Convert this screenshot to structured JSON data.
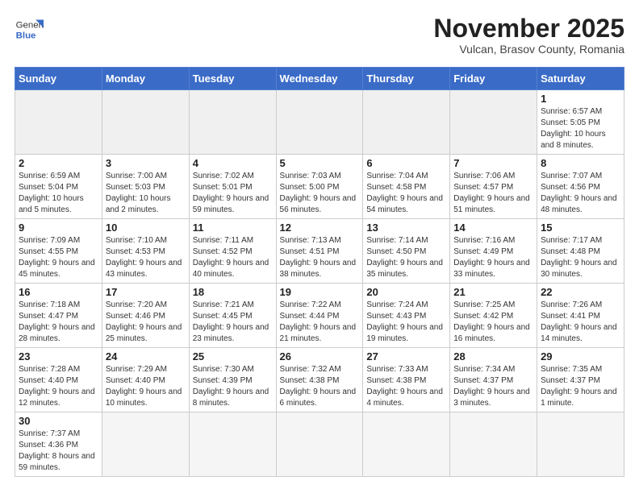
{
  "header": {
    "logo_general": "General",
    "logo_blue": "Blue",
    "month_title": "November 2025",
    "subtitle": "Vulcan, Brasov County, Romania"
  },
  "weekdays": [
    "Sunday",
    "Monday",
    "Tuesday",
    "Wednesday",
    "Thursday",
    "Friday",
    "Saturday"
  ],
  "weeks": [
    [
      {
        "day": "",
        "info": ""
      },
      {
        "day": "",
        "info": ""
      },
      {
        "day": "",
        "info": ""
      },
      {
        "day": "",
        "info": ""
      },
      {
        "day": "",
        "info": ""
      },
      {
        "day": "",
        "info": ""
      },
      {
        "day": "1",
        "info": "Sunrise: 6:57 AM\nSunset: 5:05 PM\nDaylight: 10 hours and 8 minutes."
      }
    ],
    [
      {
        "day": "2",
        "info": "Sunrise: 6:59 AM\nSunset: 5:04 PM\nDaylight: 10 hours and 5 minutes."
      },
      {
        "day": "3",
        "info": "Sunrise: 7:00 AM\nSunset: 5:03 PM\nDaylight: 10 hours and 2 minutes."
      },
      {
        "day": "4",
        "info": "Sunrise: 7:02 AM\nSunset: 5:01 PM\nDaylight: 9 hours and 59 minutes."
      },
      {
        "day": "5",
        "info": "Sunrise: 7:03 AM\nSunset: 5:00 PM\nDaylight: 9 hours and 56 minutes."
      },
      {
        "day": "6",
        "info": "Sunrise: 7:04 AM\nSunset: 4:58 PM\nDaylight: 9 hours and 54 minutes."
      },
      {
        "day": "7",
        "info": "Sunrise: 7:06 AM\nSunset: 4:57 PM\nDaylight: 9 hours and 51 minutes."
      },
      {
        "day": "8",
        "info": "Sunrise: 7:07 AM\nSunset: 4:56 PM\nDaylight: 9 hours and 48 minutes."
      }
    ],
    [
      {
        "day": "9",
        "info": "Sunrise: 7:09 AM\nSunset: 4:55 PM\nDaylight: 9 hours and 45 minutes."
      },
      {
        "day": "10",
        "info": "Sunrise: 7:10 AM\nSunset: 4:53 PM\nDaylight: 9 hours and 43 minutes."
      },
      {
        "day": "11",
        "info": "Sunrise: 7:11 AM\nSunset: 4:52 PM\nDaylight: 9 hours and 40 minutes."
      },
      {
        "day": "12",
        "info": "Sunrise: 7:13 AM\nSunset: 4:51 PM\nDaylight: 9 hours and 38 minutes."
      },
      {
        "day": "13",
        "info": "Sunrise: 7:14 AM\nSunset: 4:50 PM\nDaylight: 9 hours and 35 minutes."
      },
      {
        "day": "14",
        "info": "Sunrise: 7:16 AM\nSunset: 4:49 PM\nDaylight: 9 hours and 33 minutes."
      },
      {
        "day": "15",
        "info": "Sunrise: 7:17 AM\nSunset: 4:48 PM\nDaylight: 9 hours and 30 minutes."
      }
    ],
    [
      {
        "day": "16",
        "info": "Sunrise: 7:18 AM\nSunset: 4:47 PM\nDaylight: 9 hours and 28 minutes."
      },
      {
        "day": "17",
        "info": "Sunrise: 7:20 AM\nSunset: 4:46 PM\nDaylight: 9 hours and 25 minutes."
      },
      {
        "day": "18",
        "info": "Sunrise: 7:21 AM\nSunset: 4:45 PM\nDaylight: 9 hours and 23 minutes."
      },
      {
        "day": "19",
        "info": "Sunrise: 7:22 AM\nSunset: 4:44 PM\nDaylight: 9 hours and 21 minutes."
      },
      {
        "day": "20",
        "info": "Sunrise: 7:24 AM\nSunset: 4:43 PM\nDaylight: 9 hours and 19 minutes."
      },
      {
        "day": "21",
        "info": "Sunrise: 7:25 AM\nSunset: 4:42 PM\nDaylight: 9 hours and 16 minutes."
      },
      {
        "day": "22",
        "info": "Sunrise: 7:26 AM\nSunset: 4:41 PM\nDaylight: 9 hours and 14 minutes."
      }
    ],
    [
      {
        "day": "23",
        "info": "Sunrise: 7:28 AM\nSunset: 4:40 PM\nDaylight: 9 hours and 12 minutes."
      },
      {
        "day": "24",
        "info": "Sunrise: 7:29 AM\nSunset: 4:40 PM\nDaylight: 9 hours and 10 minutes."
      },
      {
        "day": "25",
        "info": "Sunrise: 7:30 AM\nSunset: 4:39 PM\nDaylight: 9 hours and 8 minutes."
      },
      {
        "day": "26",
        "info": "Sunrise: 7:32 AM\nSunset: 4:38 PM\nDaylight: 9 hours and 6 minutes."
      },
      {
        "day": "27",
        "info": "Sunrise: 7:33 AM\nSunset: 4:38 PM\nDaylight: 9 hours and 4 minutes."
      },
      {
        "day": "28",
        "info": "Sunrise: 7:34 AM\nSunset: 4:37 PM\nDaylight: 9 hours and 3 minutes."
      },
      {
        "day": "29",
        "info": "Sunrise: 7:35 AM\nSunset: 4:37 PM\nDaylight: 9 hours and 1 minute."
      }
    ],
    [
      {
        "day": "30",
        "info": "Sunrise: 7:37 AM\nSunset: 4:36 PM\nDaylight: 8 hours and 59 minutes."
      },
      {
        "day": "",
        "info": ""
      },
      {
        "day": "",
        "info": ""
      },
      {
        "day": "",
        "info": ""
      },
      {
        "day": "",
        "info": ""
      },
      {
        "day": "",
        "info": ""
      },
      {
        "day": "",
        "info": ""
      }
    ]
  ]
}
